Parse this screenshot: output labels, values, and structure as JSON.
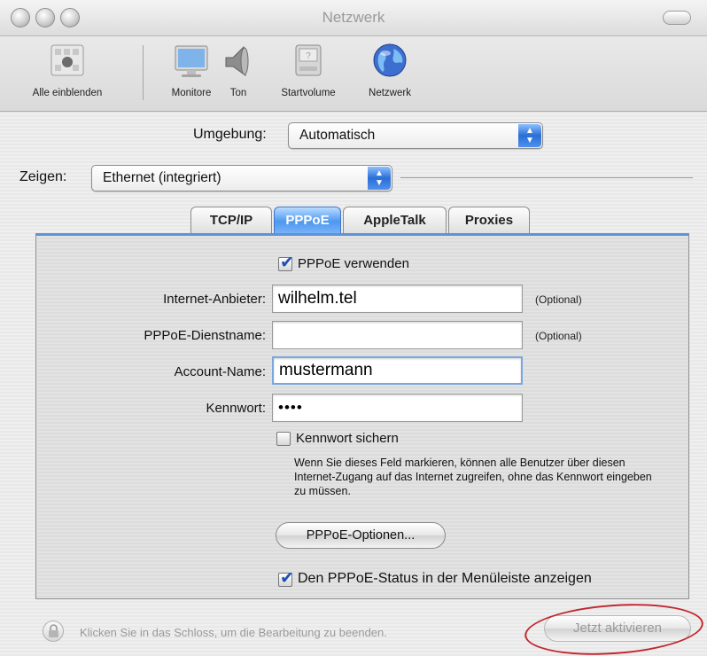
{
  "window": {
    "title": "Netzwerk"
  },
  "toolbar": {
    "items": [
      {
        "label": "Alle einblenden",
        "icon": "apple-grid-icon"
      },
      {
        "label": "Monitore",
        "icon": "monitor-icon"
      },
      {
        "label": "Ton",
        "icon": "speaker-icon"
      },
      {
        "label": "Startvolume",
        "icon": "disk-icon"
      },
      {
        "label": "Netzwerk",
        "icon": "globe-icon"
      }
    ]
  },
  "location": {
    "label": "Umgebung:",
    "value": "Automatisch"
  },
  "show": {
    "label": "Zeigen:",
    "value": "Ethernet (integriert)"
  },
  "tabs": [
    {
      "label": "TCP/IP",
      "active": false
    },
    {
      "label": "PPPoE",
      "active": true
    },
    {
      "label": "AppleTalk",
      "active": false
    },
    {
      "label": "Proxies",
      "active": false
    }
  ],
  "pppoe": {
    "use_label": "PPPoE verwenden",
    "use_checked": true,
    "provider_label": "Internet-Anbieter:",
    "provider_value": "wilhelm.tel",
    "provider_hint": "(Optional)",
    "service_label": "PPPoE-Dienstname:",
    "service_value": "",
    "service_hint": "(Optional)",
    "account_label": "Account-Name:",
    "account_value": "mustermann",
    "password_label": "Kennwort:",
    "password_value": "••••",
    "save_password_label": "Kennwort sichern",
    "save_password_checked": false,
    "help_text": "Wenn Sie dieses Feld markieren, können alle Benutzer über diesen Internet-Zugang auf das Internet zugreifen, ohne das Kennwort eingeben zu müssen.",
    "options_button": "PPPoE-Optionen...",
    "status_label": "Den PPPoE-Status in der Menüleiste anzeigen",
    "status_checked": true
  },
  "footer": {
    "lock_text": "Klicken Sie in das Schloss, um die Bearbeitung zu beenden.",
    "apply_button": "Jetzt aktivieren"
  },
  "colors": {
    "accent": "#4d98f0",
    "annotation": "#c1272d"
  }
}
